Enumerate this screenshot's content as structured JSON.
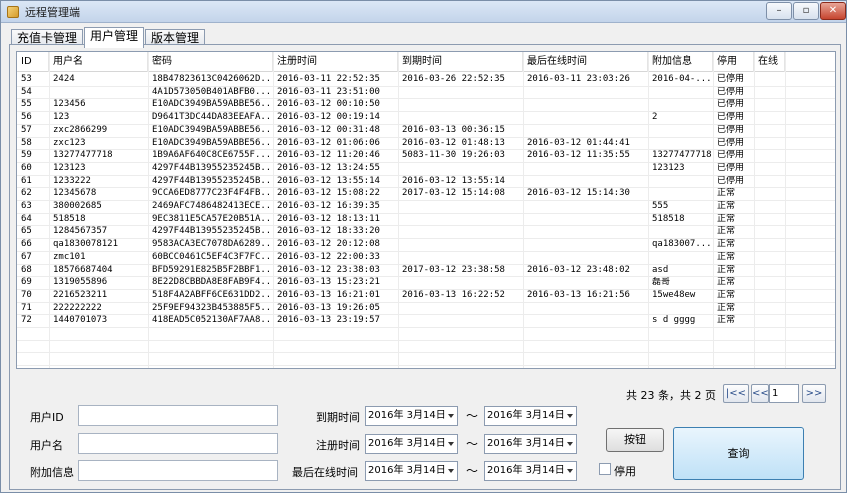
{
  "window": {
    "title": "远程管理端"
  },
  "tabs": [
    {
      "label": "充值卡管理",
      "active": false
    },
    {
      "label": "用户管理",
      "active": true
    },
    {
      "label": "版本管理",
      "active": false
    }
  ],
  "table": {
    "columns": [
      "ID",
      "用户名",
      "密码",
      "注册时间",
      "到期时间",
      "最后在线时间",
      "附加信息",
      "停用",
      "在线"
    ],
    "rows": [
      [
        "53",
        "2424",
        "18B47823613C0426062D...",
        "2016-03-11 22:52:35",
        "2016-03-26 22:52:35",
        "2016-03-11 23:03:26",
        "2016-04-...",
        "已停用",
        ""
      ],
      [
        "54",
        "",
        "4A1D573050B401ABFB0...",
        "2016-03-11 23:51:00",
        "",
        "",
        "",
        "已停用",
        ""
      ],
      [
        "55",
        "123456",
        "E10ADC3949BA59ABBE56...",
        "2016-03-12 00:10:50",
        "",
        "",
        "",
        "已停用",
        ""
      ],
      [
        "56",
        "123",
        "D9641T3DC44DA83EEAFA...",
        "2016-03-12 00:19:14",
        "",
        "",
        "2",
        "已停用",
        ""
      ],
      [
        "57",
        "zxc2866299",
        "E10ADC3949BA59ABBE56...",
        "2016-03-12 00:31:48",
        "2016-03-13 00:36:15",
        "",
        "",
        "已停用",
        ""
      ],
      [
        "58",
        "zxc123",
        "E10ADC3949BA59ABBE56...",
        "2016-03-12 01:06:06",
        "2016-03-12 01:48:13",
        "2016-03-12 01:44:41",
        "",
        "已停用",
        ""
      ],
      [
        "59",
        "13277477718",
        "1B9A6AF640C8CE6755F...",
        "2016-03-12 11:20:46",
        "5083-11-30 19:26:03",
        "2016-03-12 11:35:55",
        "13277477718",
        "已停用",
        ""
      ],
      [
        "60",
        "123123",
        "4297F44B13955235245B...",
        "2016-03-12 13:24:55",
        "",
        "",
        "123123",
        "已停用",
        ""
      ],
      [
        "61",
        "1233222",
        "4297F44B13955235245B...",
        "2016-03-12 13:55:14",
        "2016-03-12 13:55:14",
        "",
        "",
        "已停用",
        ""
      ],
      [
        "62",
        "12345678",
        "9CCA6ED8777C23F4F4FB...",
        "2016-03-12 15:08:22",
        "2017-03-12 15:14:08",
        "2016-03-12 15:14:30",
        "",
        "正常",
        ""
      ],
      [
        "63",
        "380002685",
        "2469AFC7486482413ECE...",
        "2016-03-12 16:39:35",
        "",
        "",
        "555",
        "正常",
        ""
      ],
      [
        "64",
        "518518",
        "9EC3811E5CA57E20B51A...",
        "2016-03-12 18:13:11",
        "",
        "",
        "518518",
        "正常",
        ""
      ],
      [
        "65",
        "1284567357",
        "4297F44B13955235245B...",
        "2016-03-12 18:33:20",
        "",
        "",
        "",
        "正常",
        ""
      ],
      [
        "66",
        "qa1830078121",
        "9583ACA3EC7078DA6289...",
        "2016-03-12 20:12:08",
        "",
        "",
        "qa183007...",
        "正常",
        ""
      ],
      [
        "67",
        "zmc101",
        "60BCC0461C5EF4C3F7FC...",
        "2016-03-12 22:00:33",
        "",
        "",
        "",
        "正常",
        ""
      ],
      [
        "68",
        "18576687404",
        "BFD59291E825B5F2BBF1...",
        "2016-03-12 23:38:03",
        "2017-03-12 23:38:58",
        "2016-03-12 23:48:02",
        "asd",
        "正常",
        ""
      ],
      [
        "69",
        "1319055896",
        "8E22D8CBBDA8E8FAB9F4...",
        "2016-03-13 15:23:21",
        "",
        "",
        "磊哥",
        "正常",
        ""
      ],
      [
        "70",
        "2216523211",
        "518F4A2ABFF6CE631DD2...",
        "2016-03-13 16:21:01",
        "2016-03-13 16:22:52",
        "2016-03-13 16:21:56",
        "15we48ew",
        "正常",
        ""
      ],
      [
        "71",
        "222222222",
        "25F9EF94323B453885F5...",
        "2016-03-13 19:26:05",
        "",
        "",
        "",
        "正常",
        ""
      ],
      [
        "72",
        "1440701073",
        "418EAD5C052130AF7AA8...",
        "2016-03-13 23:19:57",
        "",
        "",
        "s  d  gggg",
        "正常",
        ""
      ]
    ]
  },
  "pager": {
    "summary": "共 23 条，共 2 页",
    "first_label": "|<<",
    "prev_label": "<<",
    "page_value": "1",
    "next_label": ">>"
  },
  "filters": {
    "user_id_label": "用户ID",
    "user_id_value": "",
    "username_label": "用户名",
    "username_value": "",
    "extra_label": "附加信息",
    "extra_value": "",
    "expire_label": "到期时间",
    "expire_from": "2016年 3月14日",
    "expire_to": "2016年 3月14日",
    "register_label": "注册时间",
    "register_from": "2016年 3月14日",
    "register_to": "2016年 3月14日",
    "lastonline_label": "最后在线时间",
    "lastonline_from": "2016年 3月14日",
    "lastonline_to": "2016年 3月14日",
    "range_sep": "～",
    "button_label": "按钮",
    "disabled_label": "停用",
    "query_label": "查询"
  }
}
